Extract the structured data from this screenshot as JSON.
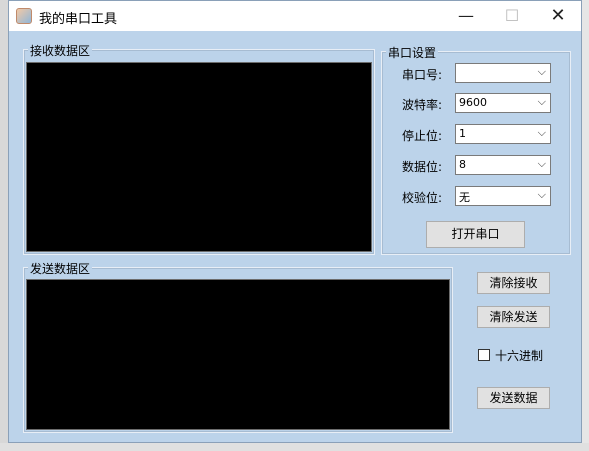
{
  "window": {
    "title": "我的串口工具",
    "controls": {
      "minimize": "—",
      "maximize": "☐",
      "close": "✕"
    }
  },
  "receive_group": {
    "label": "接收数据区"
  },
  "send_group": {
    "label": "发送数据区"
  },
  "serial_settings": {
    "label": "串口设置",
    "fields": [
      {
        "label": "串口号:",
        "value": ""
      },
      {
        "label": "波特率:",
        "value": "9600"
      },
      {
        "label": "停止位:",
        "value": "1"
      },
      {
        "label": "数据位:",
        "value": "8"
      },
      {
        "label": "校验位:",
        "value": "无"
      }
    ],
    "open_button": "打开串口"
  },
  "actions": {
    "clear_receive": "清除接收",
    "clear_send": "清除发送",
    "hex_label": "十六进制",
    "hex_checked": false,
    "send_data": "发送数据"
  }
}
